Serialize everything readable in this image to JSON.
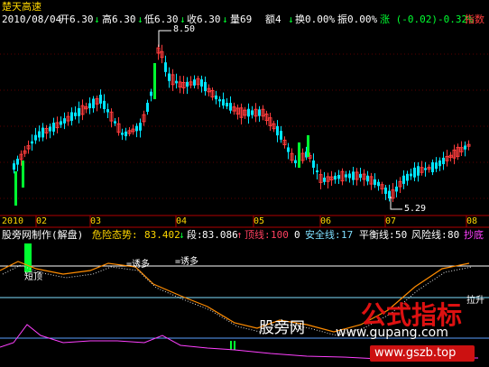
{
  "colors": {
    "background": "#000000",
    "up": "#ff3c3c",
    "down": "#00e5ff",
    "label_yellow": "#ffd700",
    "label_white": "#ffffff",
    "volume_up": "#00ff30",
    "danger_line": "#ff8c00",
    "stage_line": "#ffffff",
    "top_line": "#ff4060",
    "safe_line": "#80dfff",
    "balance_line": "#ffffff",
    "risk_line": "#ffffff",
    "bottom_line": "#ff40ff",
    "watermark_red": "#dd1111"
  },
  "header": {
    "stock_name": "楚天高速",
    "date": "2010/08/04",
    "open": "开6.30",
    "high": "高6.30",
    "low": "低6.30",
    "close": "收6.30",
    "volume": "量69",
    "amount": "额4",
    "turnover": "换0.00%",
    "amplitude": "振0.00%",
    "change": "涨 (-0.02)-0.32%",
    "index_tab": "指数"
  },
  "price_chart": {
    "high_label": "8.50",
    "low_label": "5.29"
  },
  "timeline": {
    "year": "2010",
    "months": [
      "02",
      "03",
      "04",
      "05",
      "06",
      "07",
      "08"
    ]
  },
  "indicator": {
    "name": "股旁网制作(解盘)",
    "danger_label": "危险态势:",
    "danger_value": "83.402",
    "stage_label": "段:",
    "stage_value": "83.086",
    "top_label": "顶线:",
    "top_value": "100",
    "zero": "0",
    "safe_label": "安全线:",
    "safe_value": "17",
    "balance_label": "平衡线:",
    "balance_value": "50",
    "risk_label": "风险线:",
    "risk_value": "80",
    "bottom_label": "抄底",
    "short_top": "短顶",
    "lure_1": "=诱多",
    "lure_2": "=诱多",
    "pull_up": "拉升"
  },
  "watermark": {
    "site_cn": "股旁网",
    "site_url": "www.gupang.com",
    "logo_text": "公式指标",
    "logo_url": "www.gszb.top"
  }
}
